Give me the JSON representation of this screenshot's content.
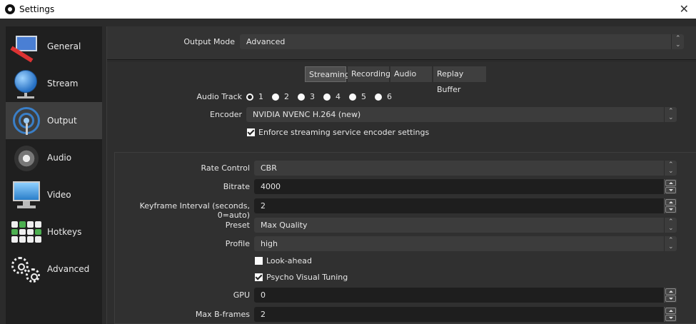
{
  "window": {
    "title": "Settings"
  },
  "sidebar": {
    "items": [
      {
        "label": "General",
        "icon": "monitor-pen-icon"
      },
      {
        "label": "Stream",
        "icon": "globe-icon"
      },
      {
        "label": "Output",
        "icon": "broadcast-icon"
      },
      {
        "label": "Audio",
        "icon": "speaker-icon"
      },
      {
        "label": "Video",
        "icon": "monitor-icon"
      },
      {
        "label": "Hotkeys",
        "icon": "keyboard-icon"
      },
      {
        "label": "Advanced",
        "icon": "gears-icon"
      }
    ],
    "active": "Output"
  },
  "output_mode": {
    "label": "Output Mode",
    "value": "Advanced"
  },
  "tabs": [
    {
      "label": "Streaming",
      "active": true
    },
    {
      "label": "Recording",
      "active": false
    },
    {
      "label": "Audio",
      "active": false
    },
    {
      "label": "Replay Buffer",
      "active": false
    }
  ],
  "streaming": {
    "audio_track": {
      "label": "Audio Track",
      "options": [
        "1",
        "2",
        "3",
        "4",
        "5",
        "6"
      ],
      "selected": "1"
    },
    "encoder": {
      "label": "Encoder",
      "value": "NVIDIA NVENC H.264 (new)"
    },
    "enforce": {
      "label": "Enforce streaming service encoder settings",
      "checked": true
    },
    "rate_control": {
      "label": "Rate Control",
      "value": "CBR"
    },
    "bitrate": {
      "label": "Bitrate",
      "value": "4000"
    },
    "keyframe": {
      "label": "Keyframe Interval (seconds, 0=auto)",
      "value": "2"
    },
    "preset": {
      "label": "Preset",
      "value": "Max Quality"
    },
    "profile": {
      "label": "Profile",
      "value": "high"
    },
    "lookahead": {
      "label": "Look-ahead",
      "checked": false
    },
    "psycho": {
      "label": "Psycho Visual Tuning",
      "checked": true
    },
    "gpu": {
      "label": "GPU",
      "value": "0"
    },
    "bframes": {
      "label": "Max B-frames",
      "value": "2"
    }
  }
}
